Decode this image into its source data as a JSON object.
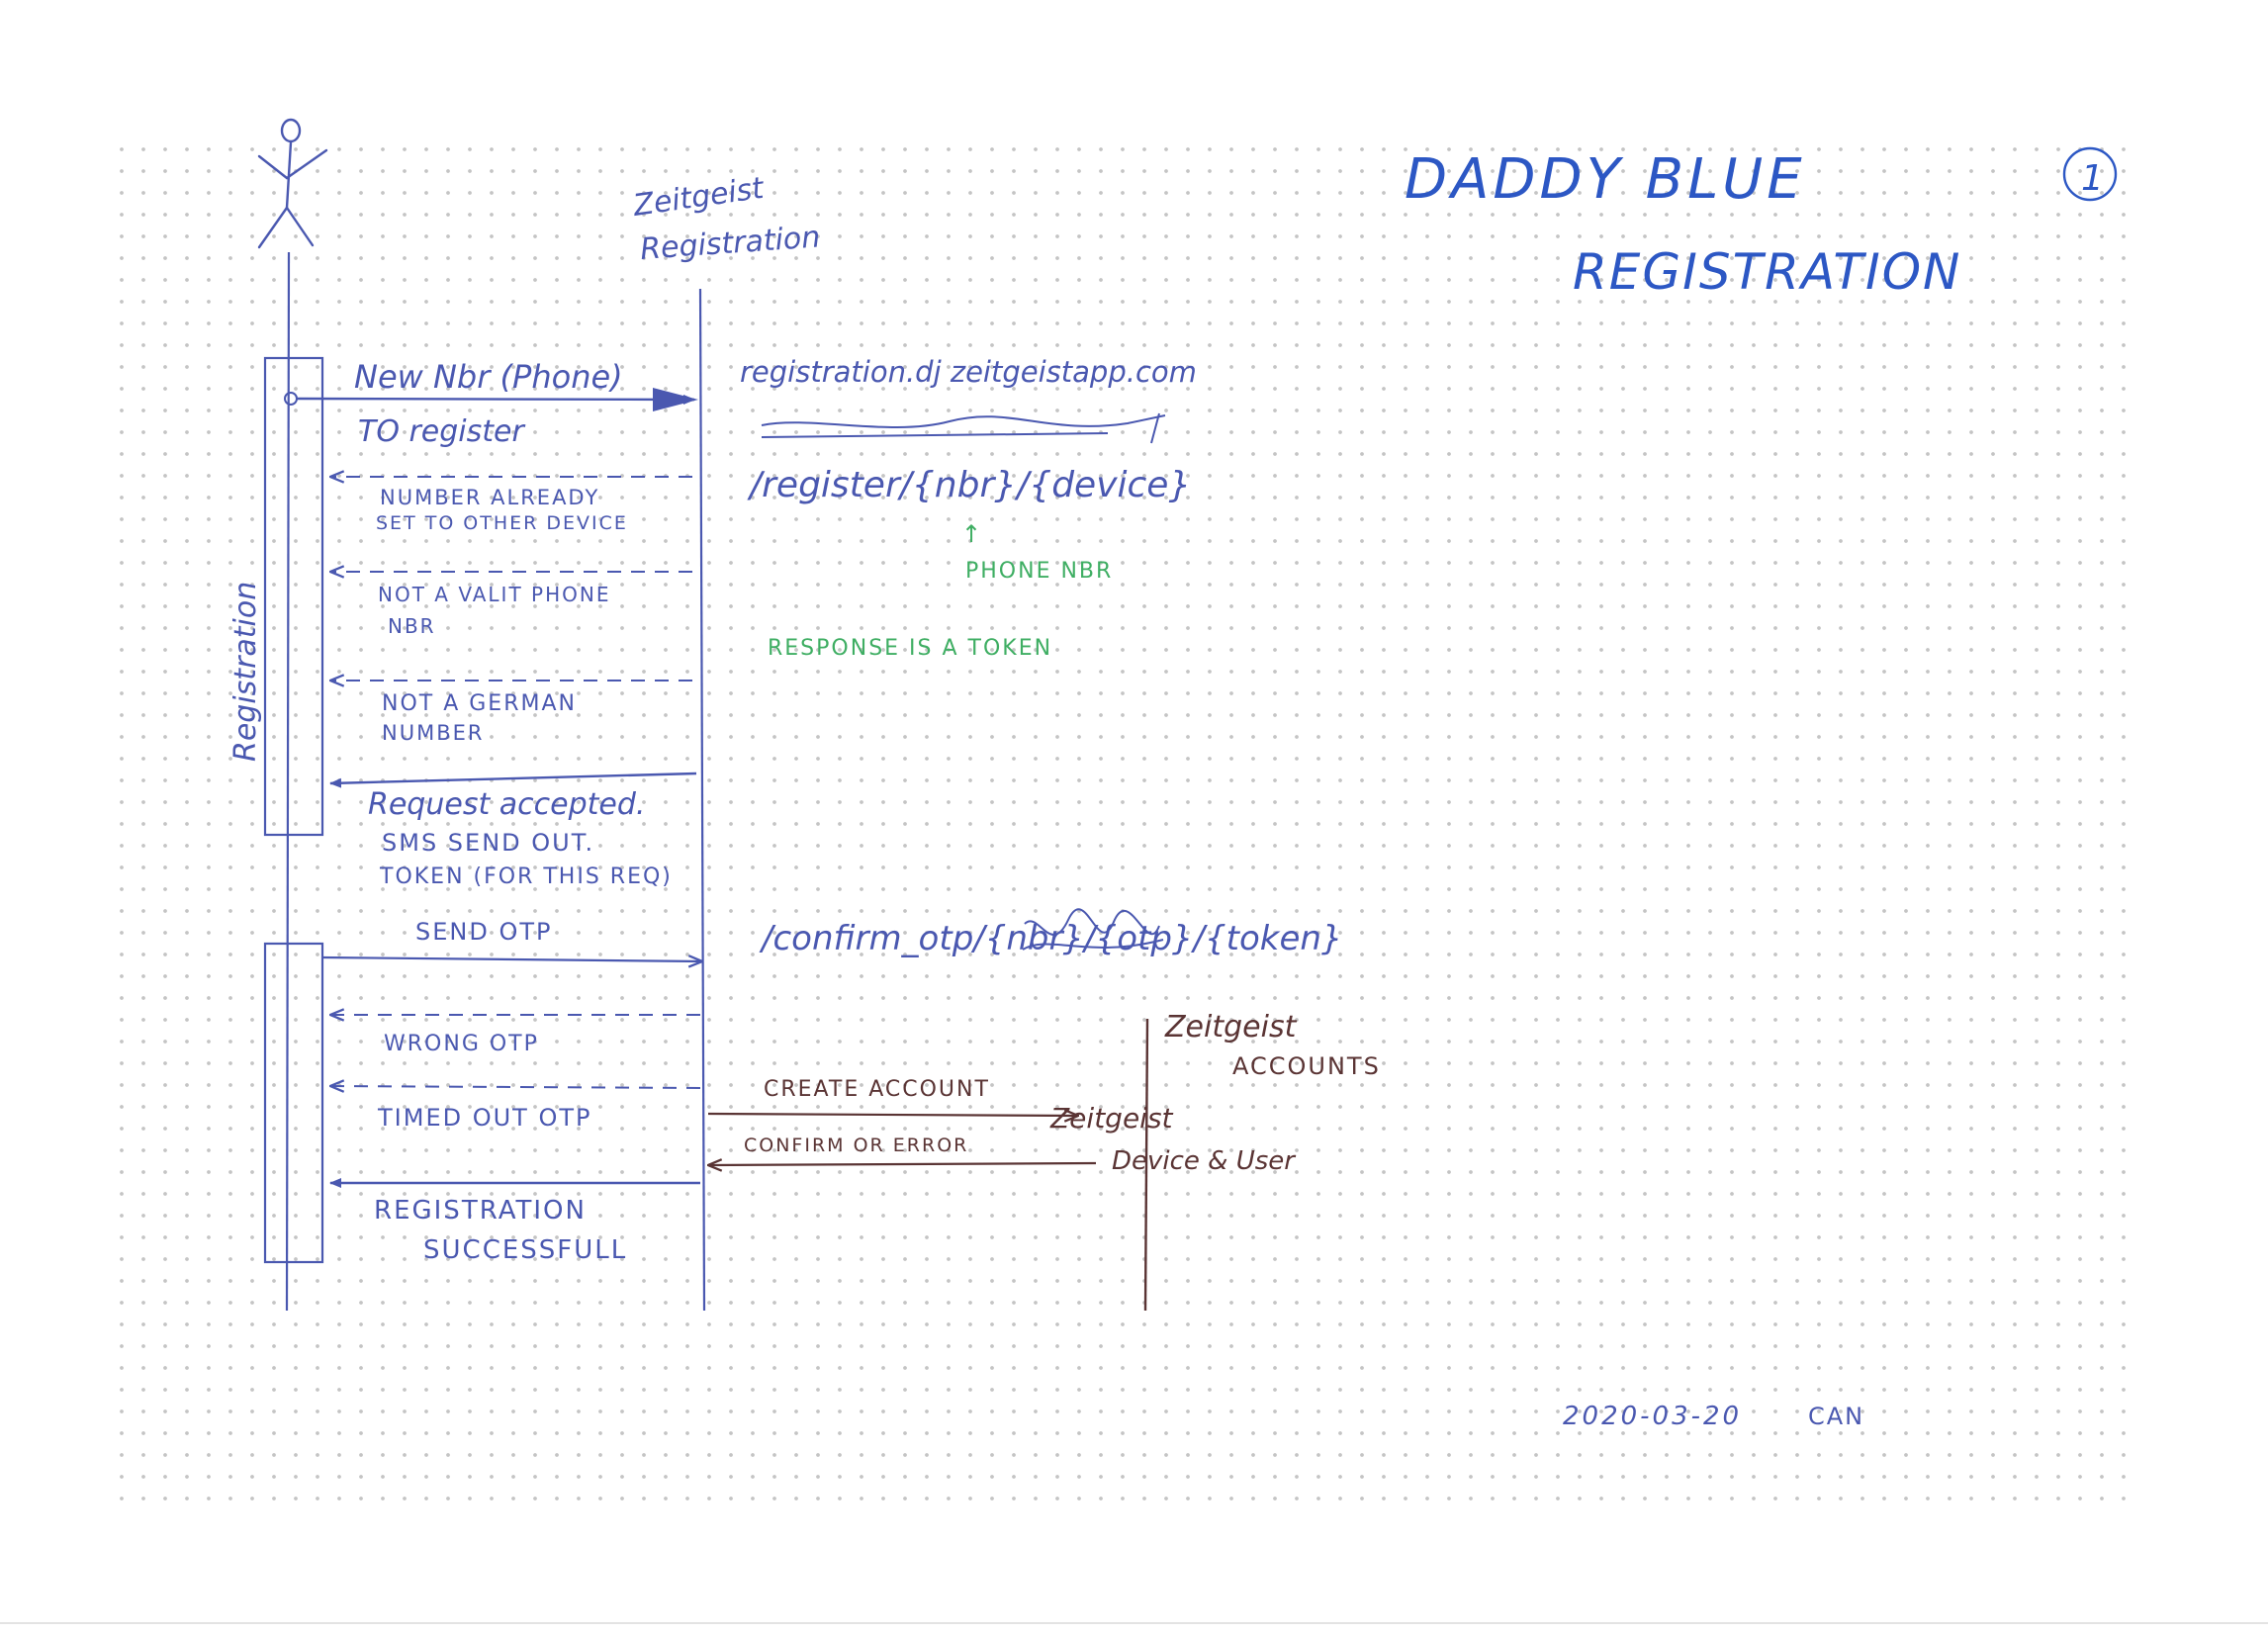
{
  "title": {
    "line1": "DADDY BLUE",
    "line2": "REGISTRATION",
    "page_number": "1"
  },
  "actors": {
    "registration_service": {
      "line1": "Zeitgeist",
      "line2": "Registration"
    },
    "accounts_service": {
      "line1": "Zeitgeist",
      "line2": "ACCOUNTS"
    }
  },
  "activation_label": "Registration",
  "messages": {
    "new_nbr": "New Nbr (Phone)",
    "to_register": "TO register",
    "already_set_1": "NUMBER ALREADY",
    "already_set_2": "SET TO OTHER DEVICE",
    "not_valid_1": "NOT A VALIT PHONE",
    "not_valid_2": "NBR",
    "not_german_1": "NOT A GERMAN",
    "not_german_2": "NUMBER",
    "accepted_1": "Request accepted.",
    "accepted_2": "SMS SEND OUT.",
    "accepted_3": "TOKEN (FOR THIS REQ)",
    "send_otp": "SEND OTP",
    "wrong_otp": "WRONG OTP",
    "timed_out_otp": "TIMED OUT OTP",
    "success_1": "REGISTRATION",
    "success_2": "SUCCESSFULL",
    "create_account": "CREATE ACCOUNT",
    "confirm_error": "CONFIRM OR ERROR",
    "device_user_1": "Zeitgeist",
    "device_user_2": "Device & User"
  },
  "notes": {
    "url": "registration.dj zeitgeistapp.com",
    "register_path": "/register/{nbr}/{device}",
    "phone_nbr": "PHONE NBR",
    "response_token": "RESPONSE IS A TOKEN",
    "confirm_path": "/confirm_otp/{nbr}/{otp}/{token}"
  },
  "footer": {
    "date": "2020-03-20",
    "author": "CAN"
  },
  "colors": {
    "ink_blue": "#4a58b0",
    "title_blue": "#2c57c4",
    "note_green": "#3fae63",
    "ink_brown": "#5a3434",
    "grid_dots": "#c4c4c4"
  }
}
